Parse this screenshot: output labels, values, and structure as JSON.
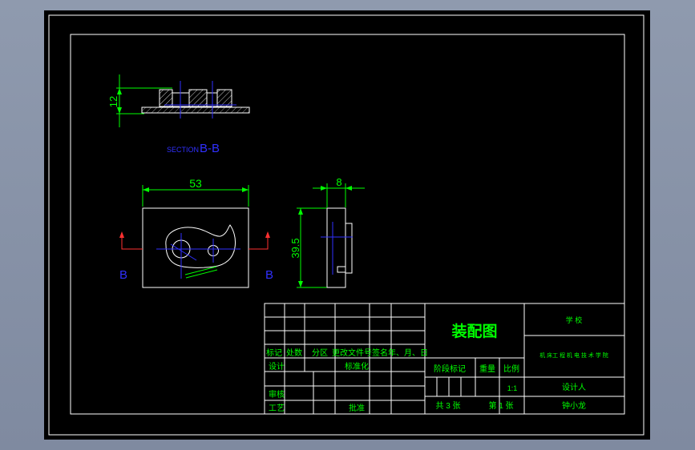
{
  "section_label": {
    "prefix": "SECTION",
    "name": "B-B"
  },
  "dimensions": {
    "thickness": "12",
    "width": "53",
    "depth": "8",
    "height": "39.5"
  },
  "cut_markers": {
    "left": "B",
    "right": "B"
  },
  "title_block": {
    "title": "装配图",
    "school": "学 校",
    "department": "机 床工 程 机 电 技 术 学 院",
    "revision_headers": [
      "标记",
      "处数",
      "分区",
      "更改文件号",
      "签名",
      "年、月、日"
    ],
    "design": "设计",
    "standardization": "标准化",
    "review": "审核",
    "process": "工艺",
    "approve": "批准",
    "stage_mark": "阶段标记",
    "weight": "重量",
    "scale_label": "比例",
    "scale_value": "1:1",
    "sheets_total": "共 3 张",
    "sheet_number": "第 1 张",
    "designer_label": "设计人",
    "designer_name": "钟小龙"
  },
  "colors": {
    "background": "#000000",
    "frame": "#ffffff",
    "annotation": "#00ff00",
    "centerline": "#2020ff",
    "cutline": "#ff0000"
  }
}
